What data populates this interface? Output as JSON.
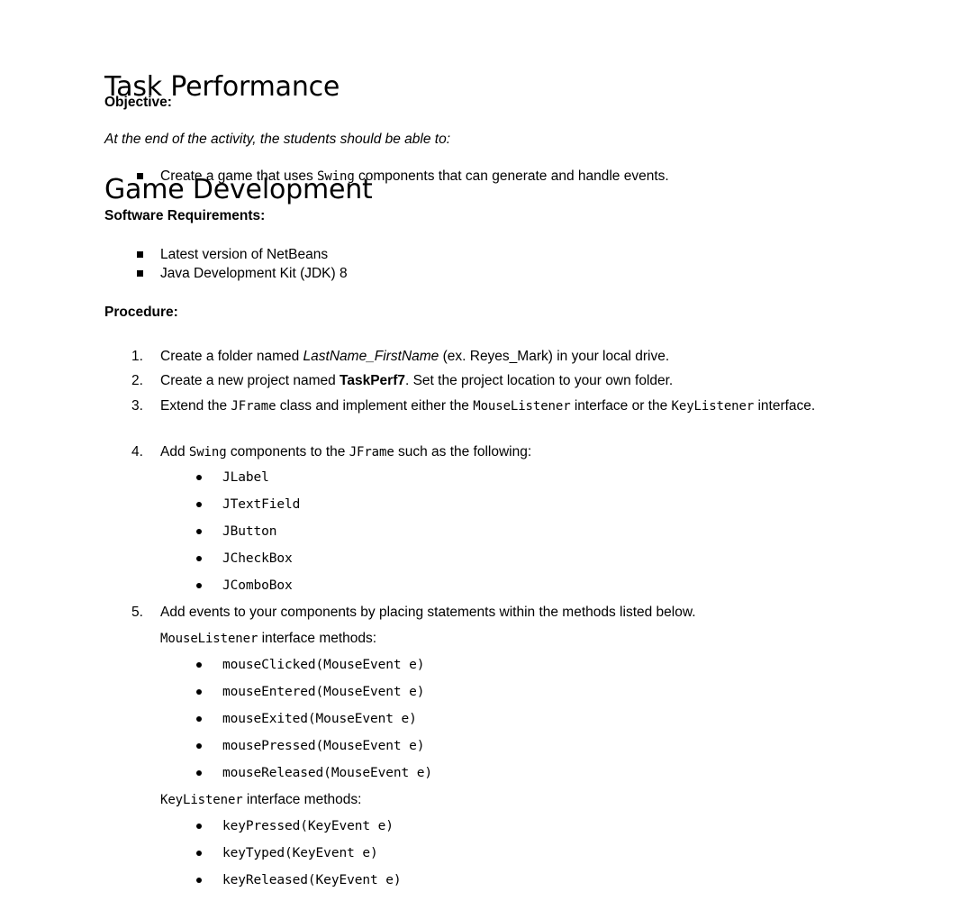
{
  "document": {
    "title_line1": "Task Performance",
    "title_line2": "Game Development",
    "objective_heading": "Objective:",
    "objective_intro": "At the end of the activity, the students should be able to:",
    "objective_items": [
      {
        "pre": "Create a game that uses ",
        "code": "Swing",
        "post": " components that can generate and handle events."
      }
    ],
    "software_heading": "Software Requirements:",
    "software_items": [
      "Latest version of NetBeans",
      "Java Development Kit (JDK) 8"
    ],
    "procedure_heading": "Procedure:",
    "procedure": [
      {
        "number": "1.",
        "parts": [
          {
            "type": "text",
            "value": "Create a folder named "
          },
          {
            "type": "italic",
            "value": "LastName_FirstName"
          },
          {
            "type": "text",
            "value": " (ex. Reyes_Mark) in your local drive."
          }
        ]
      },
      {
        "number": "2.",
        "parts": [
          {
            "type": "text",
            "value": "Create a new project named "
          },
          {
            "type": "bold",
            "value": "TaskPerf7"
          },
          {
            "type": "text",
            "value": ". Set the project location to your own folder."
          }
        ]
      },
      {
        "number": "3.",
        "parts": [
          {
            "type": "text",
            "value": "Extend the "
          },
          {
            "type": "code",
            "value": "JFrame"
          },
          {
            "type": "text",
            "value": " class and implement either the "
          },
          {
            "type": "code",
            "value": "MouseListener"
          },
          {
            "type": "text",
            "value": " interface or the "
          },
          {
            "type": "code",
            "value": "KeyListener"
          },
          {
            "type": "text",
            "value": " interface."
          }
        ]
      },
      {
        "number": "4.",
        "parts": [
          {
            "type": "text",
            "value": "Add "
          },
          {
            "type": "code",
            "value": "Swing"
          },
          {
            "type": "text",
            "value": " components to the "
          },
          {
            "type": "code",
            "value": "JFrame"
          },
          {
            "type": "text",
            "value": " such as the following:"
          }
        ]
      },
      {
        "number": "5.",
        "parts": [
          {
            "type": "text",
            "value": "Add events to your components by placing statements within the methods listed below."
          }
        ]
      }
    ],
    "swing_components": [
      "JLabel",
      "JTextField",
      "JButton",
      "JCheckBox",
      "JComboBox"
    ],
    "mouse_listener_label_code": "MouseListener",
    "mouse_listener_label_rest": " interface methods:",
    "mouse_listener_methods": [
      "mouseClicked(MouseEvent e)",
      "mouseEntered(MouseEvent e)",
      "mouseExited(MouseEvent e)",
      "mousePressed(MouseEvent e)",
      "mouseReleased(MouseEvent e)"
    ],
    "key_listener_label_code": "KeyListener",
    "key_listener_label_rest": " interface methods:",
    "key_listener_methods": [
      "keyPressed(KeyEvent e)",
      "keyTyped(KeyEvent e)",
      "keyReleased(KeyEvent e)"
    ]
  },
  "colors": {
    "text": "#000000",
    "background": "#ffffff"
  }
}
